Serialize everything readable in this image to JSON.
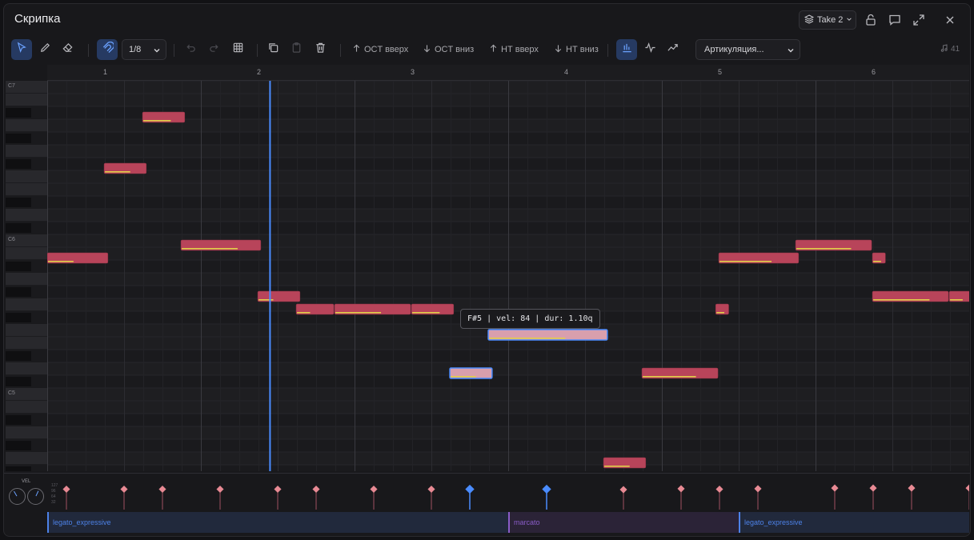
{
  "window": {
    "title": "Скрипка",
    "take_label": "Take 2"
  },
  "toolbar": {
    "grid_value": "1/8",
    "transpose_buttons": [
      {
        "label": "OCT вверх",
        "direction": "up"
      },
      {
        "label": "OCT вниз",
        "direction": "down"
      },
      {
        "label": "НТ вверх",
        "direction": "up"
      },
      {
        "label": "НТ вниз",
        "direction": "down"
      }
    ],
    "articulation_placeholder": "Артикуляция...",
    "note_count": "41"
  },
  "ruler": {
    "bars": [
      "1",
      "2",
      "3",
      "4",
      "5",
      "6"
    ]
  },
  "keyboard": {
    "octave_labels": [
      "C7",
      "C6",
      "C5"
    ]
  },
  "notes": [
    {
      "pitch": "A#5",
      "start_beat": 0.0,
      "length_beats": 0.79,
      "velocity": 0.42,
      "selected": false
    },
    {
      "pitch": "F6",
      "start_beat": 0.74,
      "length_beats": 0.55,
      "velocity": 0.6,
      "selected": false
    },
    {
      "pitch": "A6",
      "start_beat": 1.24,
      "length_beats": 0.55,
      "velocity": 0.65,
      "selected": false
    },
    {
      "pitch": "B5",
      "start_beat": 1.74,
      "length_beats": 1.04,
      "velocity": 0.7,
      "selected": false
    },
    {
      "pitch": "G5",
      "start_beat": 2.74,
      "length_beats": 0.55,
      "velocity": 0.35,
      "selected": false
    },
    {
      "pitch": "F#5",
      "start_beat": 3.24,
      "length_beats": 0.49,
      "velocity": 0.35,
      "selected": false
    },
    {
      "pitch": "F#5",
      "start_beat": 3.74,
      "length_beats": 0.99,
      "velocity": 0.6,
      "selected": false
    },
    {
      "pitch": "F#5",
      "start_beat": 4.74,
      "length_beats": 0.55,
      "velocity": 0.65,
      "selected": false
    },
    {
      "pitch": "C#5",
      "start_beat": 5.24,
      "length_beats": 0.55,
      "velocity": 0.6,
      "selected": true
    },
    {
      "pitch": "E5",
      "start_beat": 5.74,
      "length_beats": 1.55,
      "velocity": 0.64,
      "selected": true
    },
    {
      "pitch": "F#4",
      "start_beat": 7.24,
      "length_beats": 0.55,
      "velocity": 0.6,
      "selected": false
    },
    {
      "pitch": "C#5",
      "start_beat": 7.74,
      "length_beats": 0.99,
      "velocity": 0.7,
      "selected": false
    },
    {
      "pitch": "F#5",
      "start_beat": 8.7,
      "length_beats": 0.17,
      "velocity": 0.6,
      "selected": false
    },
    {
      "pitch": "A#5",
      "start_beat": 8.74,
      "length_beats": 1.04,
      "velocity": 0.65,
      "selected": false
    },
    {
      "pitch": "B5",
      "start_beat": 9.74,
      "length_beats": 0.99,
      "velocity": 0.72,
      "selected": false
    },
    {
      "pitch": "A#5",
      "start_beat": 10.74,
      "length_beats": 0.17,
      "velocity": 0.6,
      "selected": false
    },
    {
      "pitch": "G5",
      "start_beat": 10.74,
      "length_beats": 0.99,
      "velocity": 0.74,
      "selected": false
    },
    {
      "pitch": "G5",
      "start_beat": 11.74,
      "length_beats": 0.3,
      "velocity": 0.55,
      "selected": false
    }
  ],
  "playhead_beat": 2.9,
  "tooltip": {
    "text": "F#5 | vel: 84 | dur: 1.10q"
  },
  "velocity_lane": {
    "label": "VEL",
    "tick_labels": [
      "127",
      "96",
      "64",
      "32"
    ],
    "values": [
      {
        "beat": 0.25,
        "velocity": 90,
        "selected": false
      },
      {
        "beat": 1.0,
        "velocity": 90,
        "selected": false
      },
      {
        "beat": 1.5,
        "velocity": 90,
        "selected": false
      },
      {
        "beat": 2.25,
        "velocity": 90,
        "selected": false
      },
      {
        "beat": 3.0,
        "velocity": 90,
        "selected": false
      },
      {
        "beat": 3.5,
        "velocity": 90,
        "selected": false
      },
      {
        "beat": 4.25,
        "velocity": 90,
        "selected": false
      },
      {
        "beat": 5.0,
        "velocity": 90,
        "selected": false
      },
      {
        "beat": 5.5,
        "velocity": 90,
        "selected": true
      },
      {
        "beat": 6.5,
        "velocity": 90,
        "selected": true
      },
      {
        "beat": 7.5,
        "velocity": 88,
        "selected": false
      },
      {
        "beat": 8.25,
        "velocity": 92,
        "selected": false
      },
      {
        "beat": 8.75,
        "velocity": 90,
        "selected": false
      },
      {
        "beat": 9.25,
        "velocity": 92,
        "selected": false
      },
      {
        "beat": 10.25,
        "velocity": 95,
        "selected": false
      },
      {
        "beat": 10.75,
        "velocity": 95,
        "selected": false
      },
      {
        "beat": 11.25,
        "velocity": 95,
        "selected": false
      },
      {
        "beat": 12.0,
        "velocity": 95,
        "selected": false
      }
    ]
  },
  "articulation_lane": [
    {
      "label": "legato_expressive",
      "start_beat": 0.0,
      "end_beat": 6.0,
      "color": "#4d82e8"
    },
    {
      "label": "marcato",
      "start_beat": 6.0,
      "end_beat": 9.0,
      "color": "#8a5cc8"
    },
    {
      "label": "legato_expressive",
      "start_beat": 9.0,
      "end_beat": 12.2,
      "color": "#4d82e8"
    }
  ],
  "colors": {
    "note": "#b8445a",
    "note_selected": "#d99fad",
    "velocity_bar": "#e0d04a",
    "accent": "#4a8cff",
    "playhead": "#4a8cff"
  }
}
